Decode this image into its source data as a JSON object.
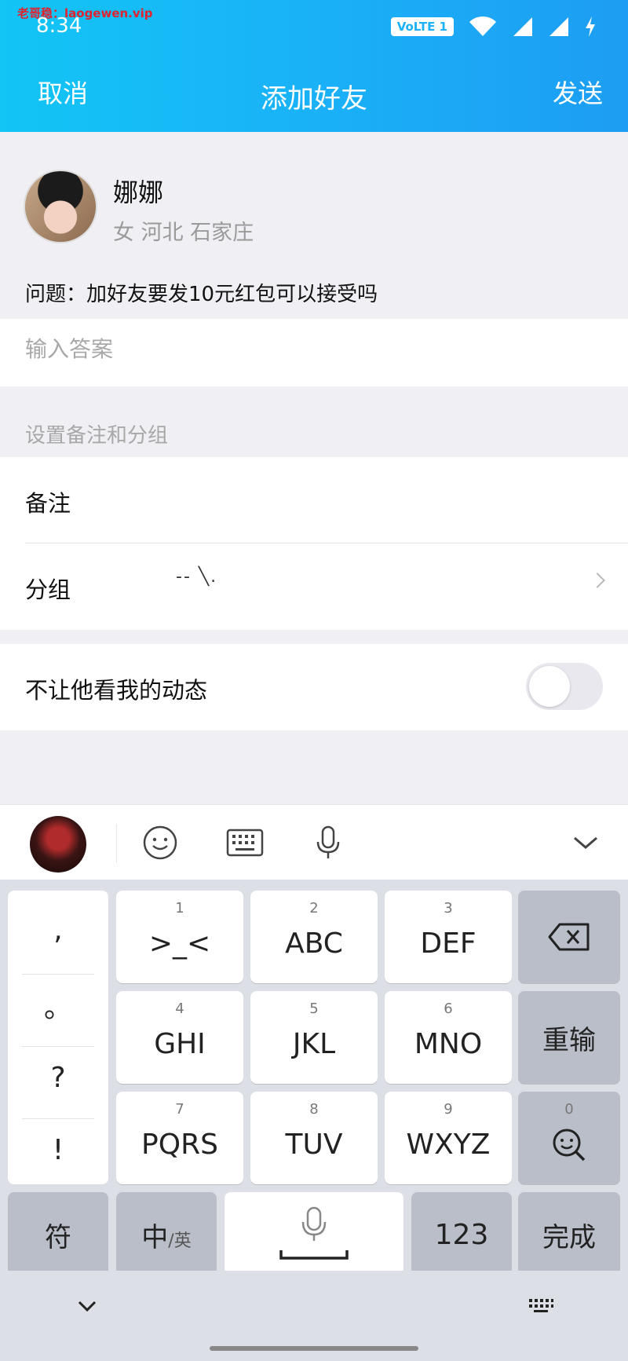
{
  "watermark": "老哥稳：laogewen.vip",
  "status_bar": {
    "time": "8:34",
    "network_badge": "VoLTE 1"
  },
  "nav": {
    "cancel": "取消",
    "title": "添加好友",
    "send": "发送"
  },
  "profile": {
    "name": "娜娜",
    "gender_location": "女  河北 石家庄",
    "question": "问题：加好友要发10元红包可以接受吗"
  },
  "answer": {
    "placeholder": "输入答案",
    "value": ""
  },
  "settings": {
    "section_label": "设置备注和分组",
    "remark_label": "备注",
    "group_label": "分组",
    "group_value": "-- ╲.",
    "hide_moments_label": "不让他看我的动态",
    "hide_moments_on": false
  },
  "toolbar": {
    "icons": [
      "emoji-icon",
      "keyboard-icon",
      "microphone-icon",
      "chevron-down-icon"
    ]
  },
  "keyboard": {
    "punctuation": [
      ",",
      "。",
      "?",
      "!"
    ],
    "keys": [
      {
        "num": "1",
        "label": ">_<"
      },
      {
        "num": "2",
        "label": "ABC"
      },
      {
        "num": "3",
        "label": "DEF"
      },
      {
        "num": "4",
        "label": "GHI"
      },
      {
        "num": "5",
        "label": "JKL"
      },
      {
        "num": "6",
        "label": "MNO"
      },
      {
        "num": "7",
        "label": "PQRS"
      },
      {
        "num": "8",
        "label": "TUV"
      },
      {
        "num": "9",
        "label": "WXYZ"
      },
      {
        "num": "0",
        "label": ""
      }
    ],
    "reinput": "重输",
    "symbol": "符",
    "lang_main": "中",
    "lang_sub": "/英",
    "num_mode": "123",
    "done": "完成"
  },
  "colors": {
    "header_start": "#12c5f5",
    "header_end": "#1d9df3",
    "watermark": "#e0222e"
  }
}
